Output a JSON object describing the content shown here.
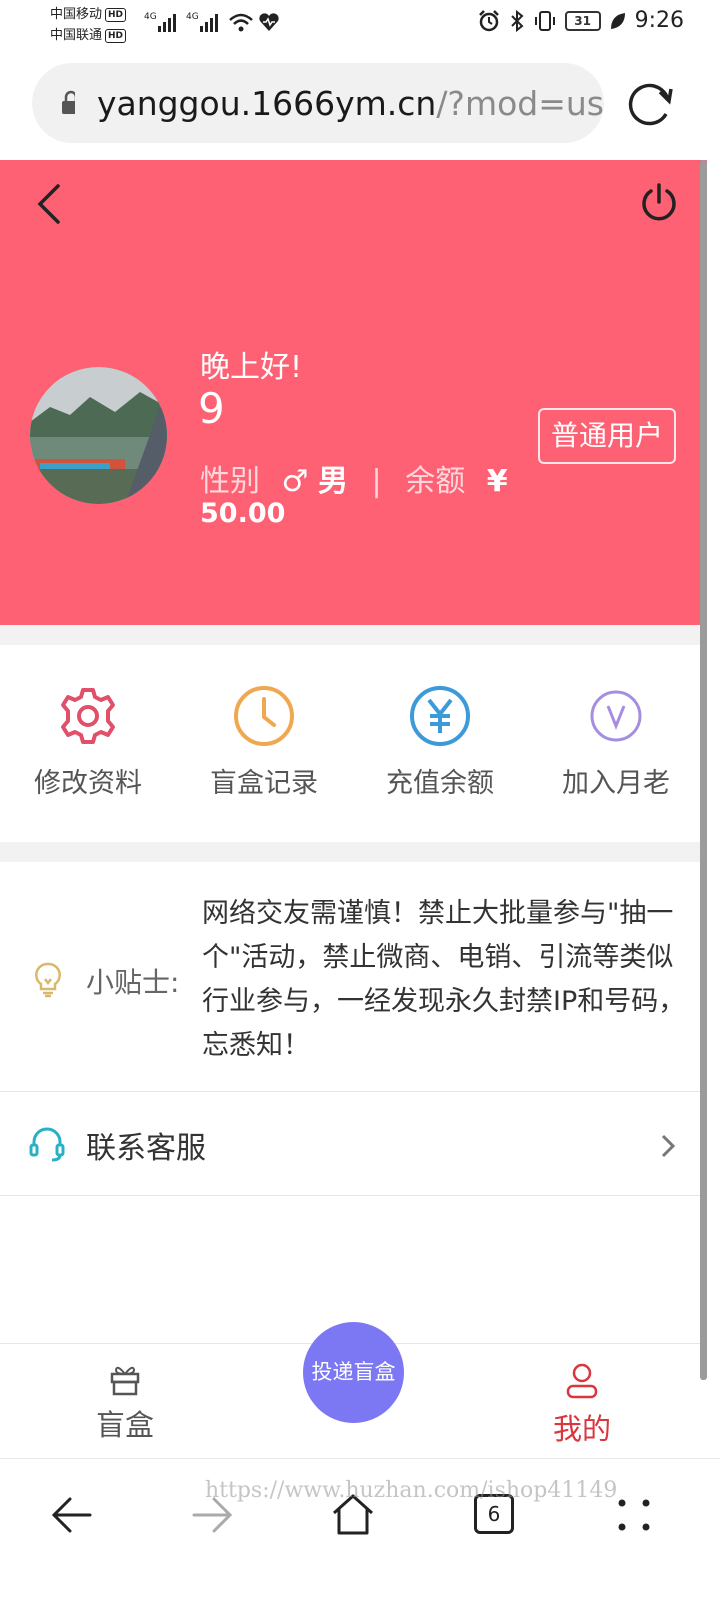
{
  "status_bar": {
    "carrier_1": "中国移动",
    "carrier_2": "中国联通",
    "hd_tag": "HD",
    "network_1": "4G",
    "network_2": "4G",
    "battery_level": "31",
    "time": "9:26"
  },
  "browser": {
    "url_host": "yanggou.1666ym.cn",
    "url_path": "/?mod=us",
    "tab_count": "6",
    "watermark": "https://www.huzhan.com/ishop41149"
  },
  "header": {
    "background_color": "#fd6173",
    "greeting": "晚上好!",
    "username": "9",
    "gender_label": "性别",
    "gender_symbol": "♂",
    "gender_value": "男",
    "separator": "|",
    "balance_label": "余额",
    "currency_symbol": "¥",
    "balance_value": "50.00",
    "badge": "普通用户"
  },
  "menu": {
    "items": [
      {
        "label": "修改资料",
        "icon": "gear-icon",
        "color": "#e0506a"
      },
      {
        "label": "盲盒记录",
        "icon": "clock-icon",
        "color": "#f0a850"
      },
      {
        "label": "充值余额",
        "icon": "yen-icon",
        "color": "#3d9ad8"
      },
      {
        "label": "加入月老",
        "icon": "v-icon",
        "color": "#a58ee0"
      }
    ]
  },
  "tips": {
    "label": "小贴士:",
    "text": "网络交友需谨慎！禁止大批量参与\"抽一个\"活动，禁止微商、电销、引流等类似行业参与，一经发现永久封禁IP和号码，忘悉知！"
  },
  "contact": {
    "label": "联系客服"
  },
  "tabbar": {
    "left_label": "盲盒",
    "center_label": "投递盲盒",
    "right_label": "我的",
    "active_color": "#d9363e",
    "inactive_color": "#555555",
    "fab_color": "#7c77f2"
  }
}
